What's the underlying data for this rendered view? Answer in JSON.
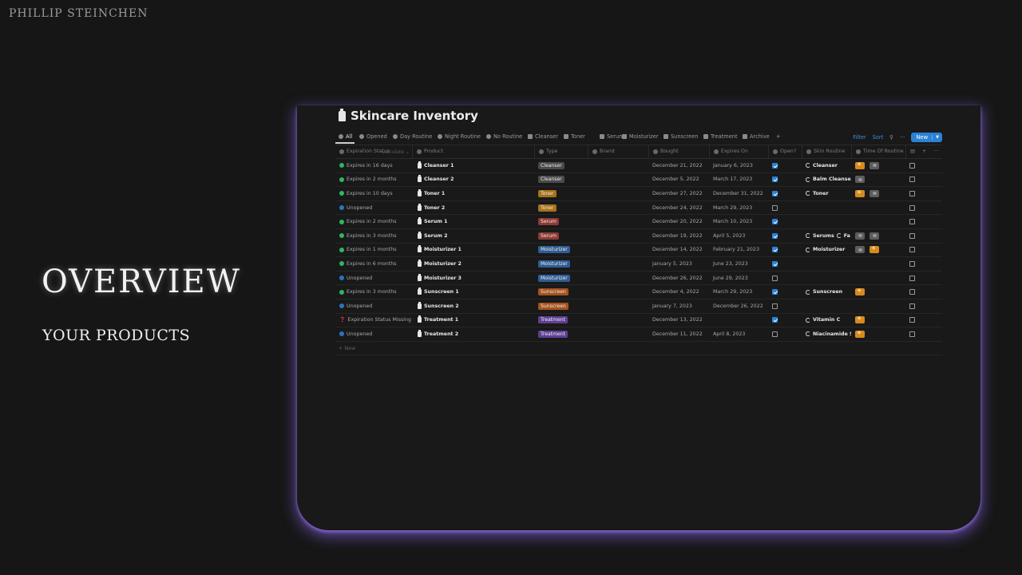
{
  "brand": "PHILLIP   STEINCHEN",
  "hero": {
    "title": "OVERVIEW",
    "subtitle": "YOUR PRODUCTS"
  },
  "page": {
    "title": "Skincare Inventory"
  },
  "tabs": [
    "All",
    "Opened",
    "Day Routine",
    "Night Routine",
    "No Routine",
    "Cleanser",
    "Toner",
    "Serum",
    "Moisturizer",
    "Sunscreen",
    "Treatment",
    "Archive"
  ],
  "actions": {
    "filter": "Filter",
    "sort": "Sort",
    "new": "New"
  },
  "columns": [
    "Expiration Status",
    "Product",
    "Type",
    "Brand",
    "Bought",
    "Expires On",
    "Open?",
    "Skin Routine",
    "Time Of Routine"
  ],
  "rows": [
    {
      "status": "Expires in 16 days",
      "status_color": "#2fb55f",
      "product": "Cleanser 1",
      "type": "Cleanser",
      "type_color": "#4a4a4a",
      "bought": "December 21, 2022",
      "expires": "January 6, 2023",
      "open": true,
      "routine": [
        "Cleanser"
      ],
      "times": [
        "day",
        "night"
      ]
    },
    {
      "status": "Expires in 2 months",
      "status_color": "#2fb55f",
      "product": "Cleanser 2",
      "type": "Cleanser",
      "type_color": "#4a4a4a",
      "bought": "December 5, 2022",
      "expires": "March 17, 2023",
      "open": true,
      "routine": [
        "Balm Cleanser"
      ],
      "times": [
        "night"
      ]
    },
    {
      "status": "Expires in 10 days",
      "status_color": "#2fb55f",
      "product": "Toner 1",
      "type": "Toner",
      "type_color": "#a8711c",
      "bought": "December 27, 2022",
      "expires": "December 31, 2022",
      "open": true,
      "routine": [
        "Toner"
      ],
      "times": [
        "day",
        "night"
      ]
    },
    {
      "status": "Unopened",
      "status_color": "#2b73c0",
      "product": "Toner 2",
      "type": "Toner",
      "type_color": "#a8711c",
      "bought": "December 24, 2022",
      "expires": "March 29, 2023",
      "open": false,
      "routine": [],
      "times": []
    },
    {
      "status": "Expires in 2 months",
      "status_color": "#2fb55f",
      "product": "Serum 1",
      "type": "Serum",
      "type_color": "#8c3b34",
      "bought": "December 20, 2022",
      "expires": "March 10, 2023",
      "open": true,
      "routine": [],
      "times": []
    },
    {
      "status": "Expires in 3 months",
      "status_color": "#2fb55f",
      "product": "Serum 2",
      "type": "Serum",
      "type_color": "#8c3b34",
      "bought": "December 19, 2022",
      "expires": "April 5, 2023",
      "open": true,
      "routine": [
        "Serums",
        "Fa"
      ],
      "times": [
        "night",
        "night"
      ]
    },
    {
      "status": "Expires in 1 months",
      "status_color": "#2fb55f",
      "product": "Moisturizer 1",
      "type": "Moisturizer",
      "type_color": "#2f5d93",
      "bought": "December 14, 2022",
      "expires": "February 21, 2023",
      "open": true,
      "routine": [
        "Moisturizer"
      ],
      "times": [
        "night",
        "day"
      ]
    },
    {
      "status": "Expires in 6 months",
      "status_color": "#2fb55f",
      "product": "Moisturizer 2",
      "type": "Moisturizer",
      "type_color": "#2f5d93",
      "bought": "January 5, 2023",
      "expires": "June 23, 2023",
      "open": true,
      "routine": [],
      "times": []
    },
    {
      "status": "Unopened",
      "status_color": "#2b73c0",
      "product": "Moisturizer 3",
      "type": "Moisturizer",
      "type_color": "#2f5d93",
      "bought": "December 26, 2022",
      "expires": "June 29, 2023",
      "open": false,
      "routine": [],
      "times": []
    },
    {
      "status": "Expires in 3 months",
      "status_color": "#2fb55f",
      "product": "Sunscreen 1",
      "type": "Sunscreen",
      "type_color": "#a5511e",
      "bought": "December 4, 2022",
      "expires": "March 29, 2023",
      "open": true,
      "routine": [
        "Sunscreen"
      ],
      "times": [
        "day"
      ]
    },
    {
      "status": "Unopened",
      "status_color": "#2b73c0",
      "product": "Sunscreen 2",
      "type": "Sunscreen",
      "type_color": "#a5511e",
      "bought": "January 7, 2023",
      "expires": "December 26, 2022",
      "open": false,
      "routine": [],
      "times": []
    },
    {
      "status": "Expiration Status Missing",
      "status_color": "#d23a3a",
      "product": "Treatment 1",
      "type": "Treatment",
      "type_color": "#5f3f93",
      "bought": "December 13, 2022",
      "expires": "",
      "open": true,
      "routine": [
        "Vitamin C"
      ],
      "times": [
        "day"
      ]
    },
    {
      "status": "Unopened",
      "status_color": "#2b73c0",
      "product": "Treatment 2",
      "type": "Treatment",
      "type_color": "#5f3f93",
      "bought": "December 11, 2022",
      "expires": "April 8, 2023",
      "open": false,
      "routine": [
        "Niacinamide Se"
      ],
      "times": [
        "day"
      ]
    }
  ],
  "footer": {
    "new": "+ New",
    "calculate": "Calculate ⌄"
  }
}
